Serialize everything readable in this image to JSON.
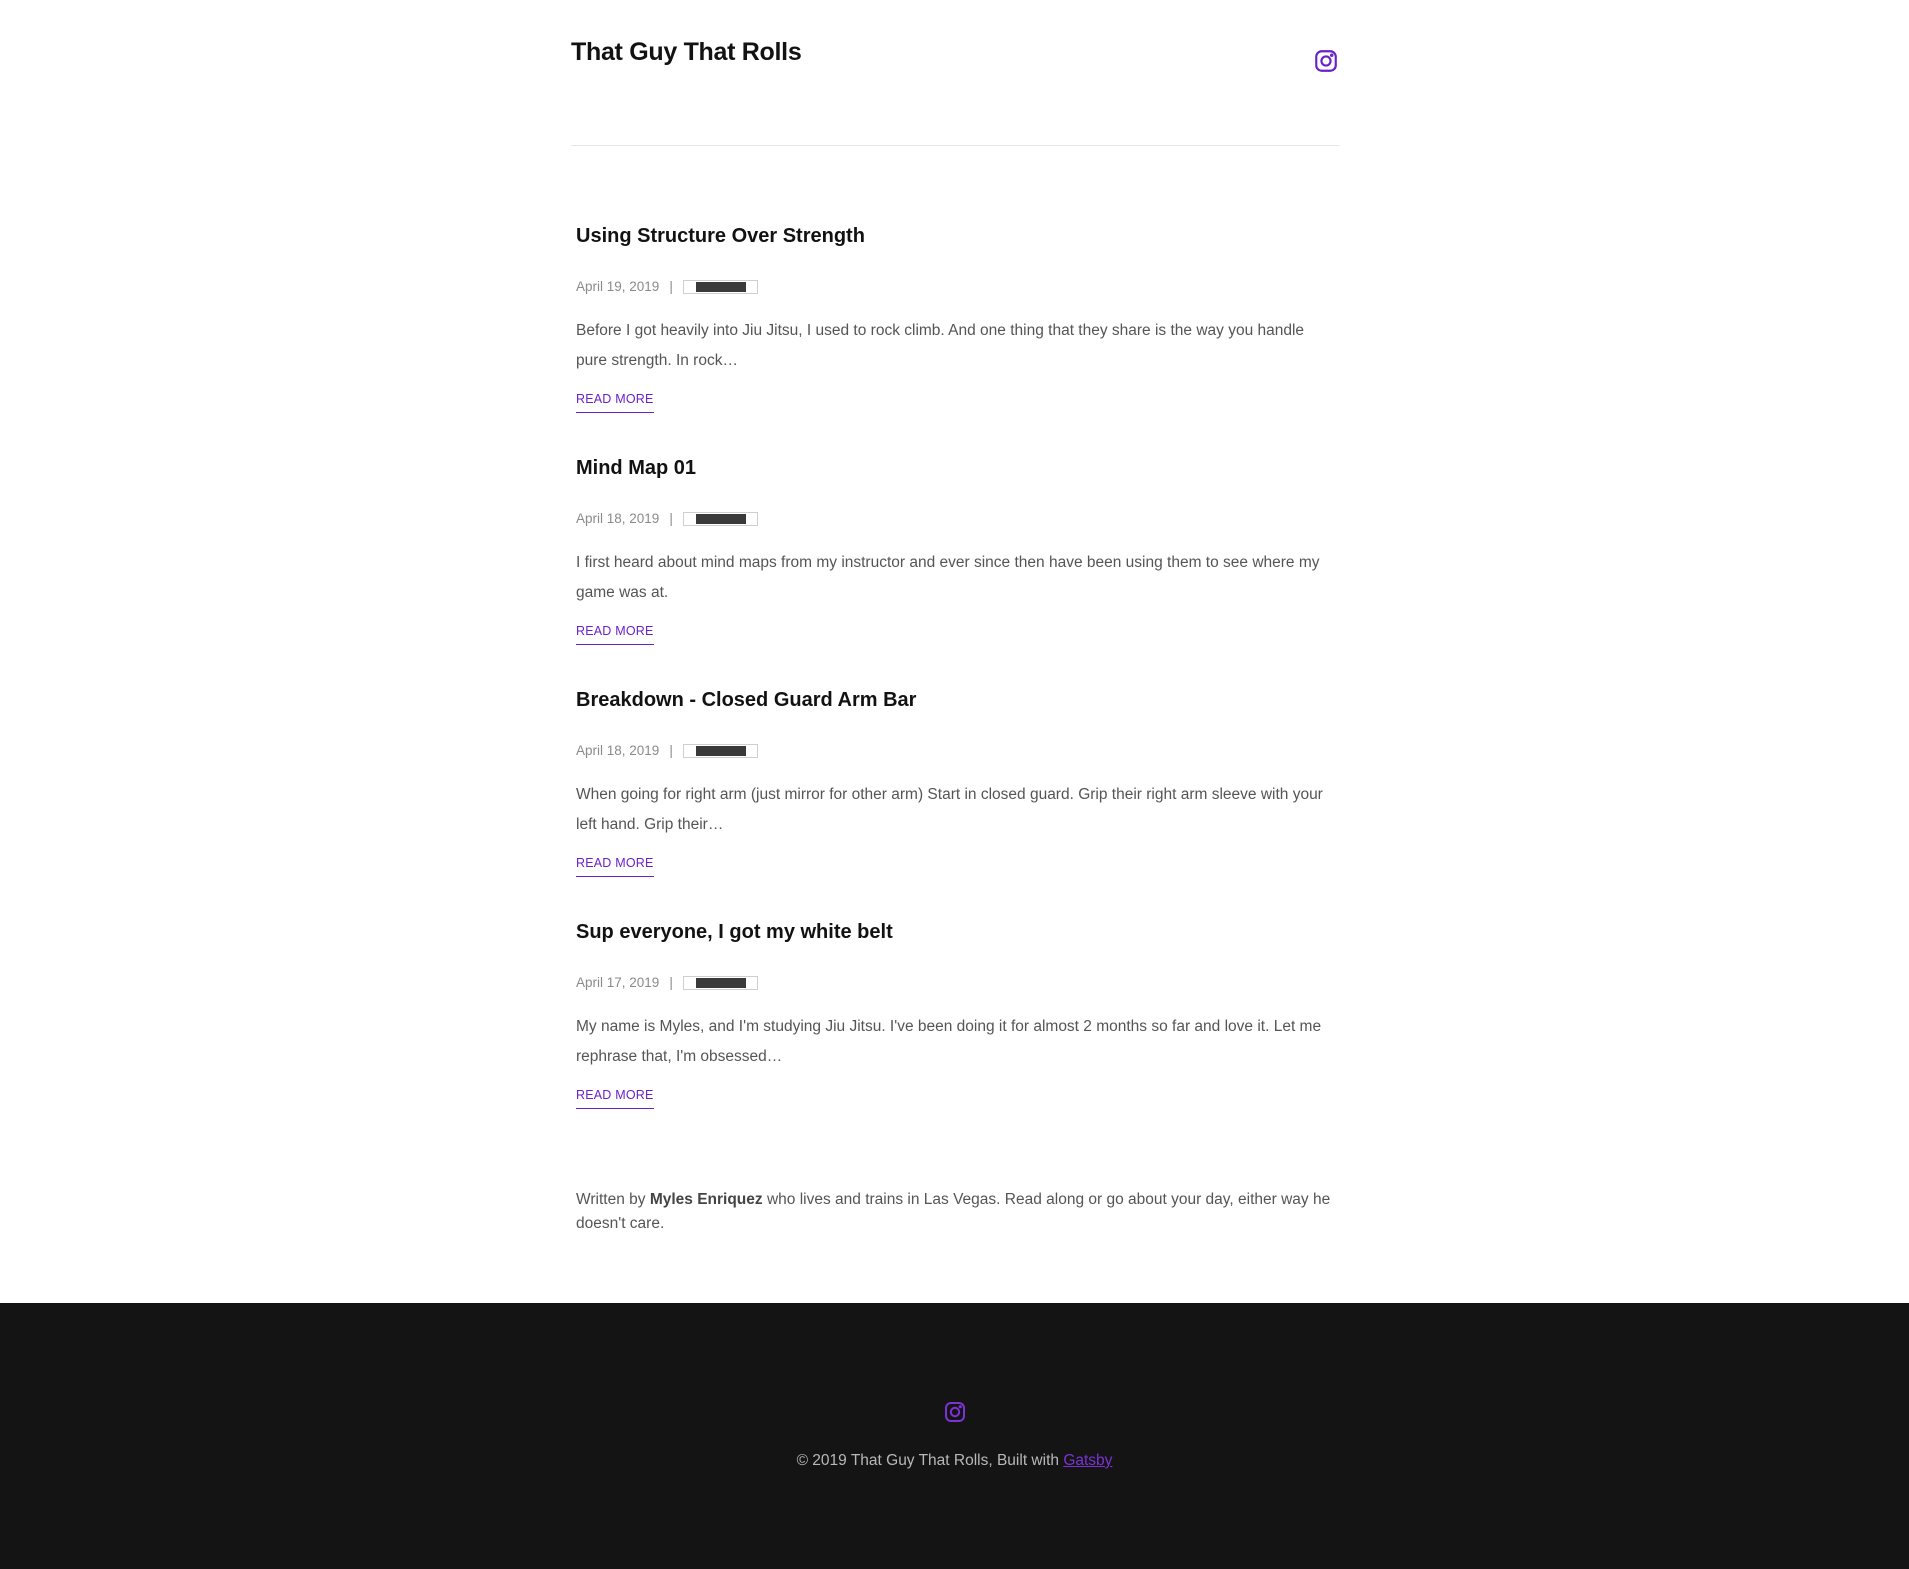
{
  "header": {
    "site_title": "That Guy That Rolls",
    "social_icon": "instagram-icon"
  },
  "posts": [
    {
      "title": "Using Structure Over Strength",
      "date": "April 19, 2019",
      "separator": "|",
      "excerpt": "Before I got heavily into Jiu Jitsu, I used to rock climb. And one thing that they share is the way you handle pure strength. In rock…",
      "read_more": "READ MORE"
    },
    {
      "title": "Mind Map 01",
      "date": "April 18, 2019",
      "separator": "|",
      "excerpt": "I first heard about mind maps from my instructor and ever since then have been using them to see where my game was at.",
      "read_more": "READ MORE"
    },
    {
      "title": "Breakdown - Closed Guard Arm Bar",
      "date": "April 18, 2019",
      "separator": "|",
      "excerpt": "When going for right arm (just mirror for other arm) Start in closed guard. Grip their right arm sleeve with your left hand. Grip their…",
      "read_more": "READ MORE"
    },
    {
      "title": "Sup everyone, I got my white belt",
      "date": "April 17, 2019",
      "separator": "|",
      "excerpt": "My name is Myles, and I'm studying Jiu Jitsu. I've been doing it for almost 2 months so far and love it. Let me rephrase that, I'm obsessed…",
      "read_more": "READ MORE"
    }
  ],
  "bio": {
    "prefix": "Written by",
    "author": "Myles Enriquez",
    "suffix": "who lives and trains in Las Vegas. Read along or go about your day, either way he doesn't care."
  },
  "footer": {
    "social_icon": "instagram-icon",
    "copyright": "© 2019 That Guy That Rolls, Built with",
    "link_text": "Gatsby"
  },
  "colors": {
    "accent": "#6b21c8",
    "footer_bg": "#141414",
    "text": "#555555",
    "title": "#121212"
  }
}
